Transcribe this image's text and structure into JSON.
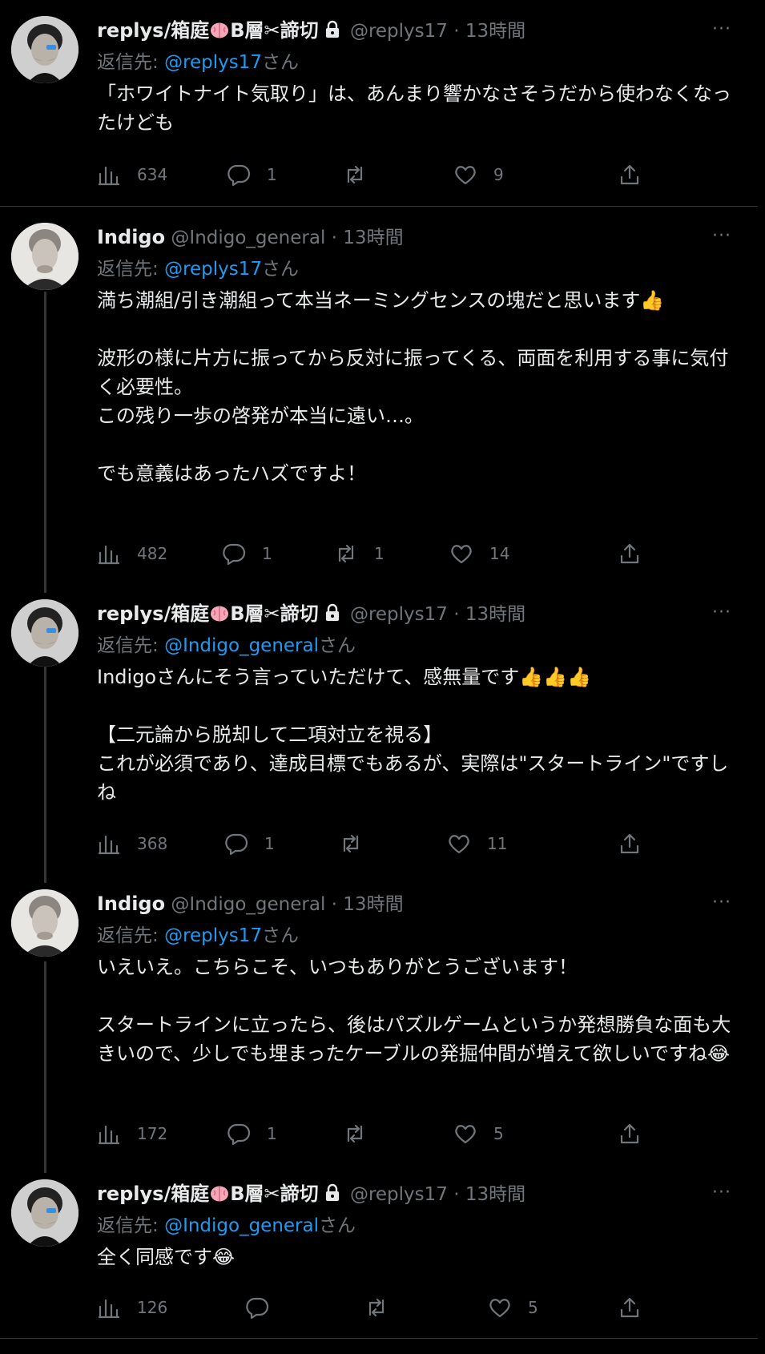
{
  "tweets": [
    {
      "display_name": "replys/箱庭",
      "name_suffix_1": "B層",
      "name_suffix_2": "✂諦切",
      "handle": "@replys17",
      "sep": "·",
      "time": "13時間",
      "reply_prefix": "返信先:",
      "reply_to": "@replys17",
      "reply_suffix": "さん",
      "text": "「ホワイトナイト気取り」は、あんまり響かなさそうだから使わなくなったけども",
      "views": "634",
      "replies": "1",
      "reposts": "",
      "likes": "9",
      "more": "···"
    },
    {
      "display_name": "Indigo",
      "handle": "@Indigo_general",
      "sep": "·",
      "time": "13時間",
      "reply_prefix": "返信先:",
      "reply_to": "@replys17",
      "reply_suffix": "さん",
      "text": "満ち潮組/引き潮組って本当ネーミングセンスの塊だと思います👍\n\n波形の様に片方に振ってから反対に振ってくる、両面を利用する事に気付く必要性。\nこの残り一歩の啓発が本当に遠い…。\n\nでも意義はあったハズですよ！",
      "views": "482",
      "replies": "1",
      "reposts": "1",
      "likes": "14",
      "more": "···"
    },
    {
      "display_name": "replys/箱庭",
      "name_suffix_1": "B層",
      "name_suffix_2": "✂諦切",
      "handle": "@replys17",
      "sep": "·",
      "time": "13時間",
      "reply_prefix": "返信先:",
      "reply_to": "@Indigo_general",
      "reply_suffix": "さん",
      "text": "Indigoさんにそう言っていただけて、感無量です👍👍👍\n\n【二元論から脱却して二項対立を視る】\nこれが必須であり、達成目標でもあるが、実際は\"スタートライン\"ですしね",
      "views": "368",
      "replies": "1",
      "reposts": "",
      "likes": "11",
      "more": "···"
    },
    {
      "display_name": "Indigo",
      "handle": "@Indigo_general",
      "sep": "·",
      "time": "13時間",
      "reply_prefix": "返信先:",
      "reply_to": "@replys17",
      "reply_suffix": "さん",
      "text": "いえいえ。こちらこそ、いつもありがとうございます！\n\nスタートラインに立ったら、後はパズルゲームというか発想勝負な面も大きいので、少しでも埋まったケーブルの発掘仲間が増えて欲しいですね😂",
      "views": "172",
      "replies": "1",
      "reposts": "",
      "likes": "5",
      "more": "···"
    },
    {
      "display_name": "replys/箱庭",
      "name_suffix_1": "B層",
      "name_suffix_2": "✂諦切",
      "handle": "@replys17",
      "sep": "·",
      "time": "13時間",
      "reply_prefix": "返信先:",
      "reply_to": "@Indigo_general",
      "reply_suffix": "さん",
      "text": "全く同感です😂",
      "views": "126",
      "replies": "",
      "reposts": "",
      "likes": "5",
      "more": "···"
    }
  ],
  "colors": {
    "background": "#000000",
    "text": "#e7e9ea",
    "muted": "#71767b",
    "link": "#1d9bf0",
    "border": "#2f3336"
  },
  "icons": [
    "views-icon",
    "reply-icon",
    "repost-icon",
    "like-icon",
    "share-icon",
    "lock-icon",
    "brain-emoji",
    "more-icon"
  ]
}
